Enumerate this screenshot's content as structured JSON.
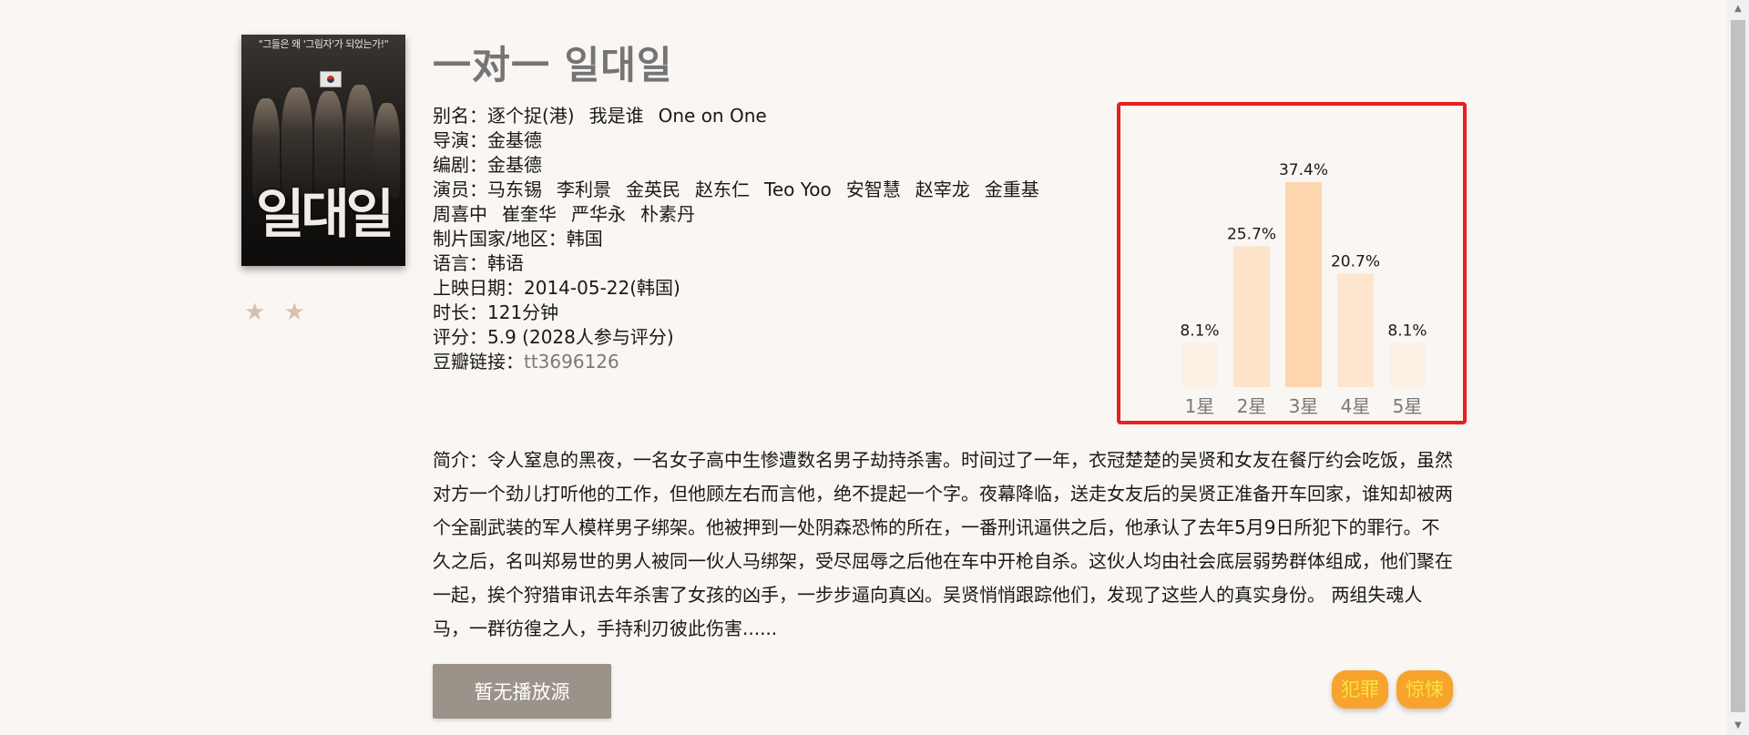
{
  "movie": {
    "title": "一对一 일대일",
    "poster_text": "\"그들은 왜 '그림자'가 되었는가!\"",
    "poster_title": "일대일",
    "rating_stars": "★ ★",
    "info": {
      "aka_label": "别名：",
      "aka": [
        "逐个捉(港)",
        "我是谁",
        "One on One"
      ],
      "director_label": "导演：",
      "director": "金基德",
      "writer_label": "编剧：",
      "writer": "金基德",
      "cast_label": "演员：",
      "cast": [
        "马东锡",
        "李利景",
        "金英民",
        "赵东仁",
        "Teo Yoo",
        "安智慧",
        "赵宰龙",
        "金重基",
        "周喜中",
        "崔奎华",
        "严华永",
        "朴素丹"
      ],
      "country_label": "制片国家/地区：",
      "country": "韩国",
      "language_label": "语言：",
      "language": "韩语",
      "release_label": "上映日期：",
      "release": "2014-05-22(韩国)",
      "runtime_label": "时长：",
      "runtime": "121分钟",
      "score_label": "评分：",
      "score": "5.9 (2028人参与评分)",
      "douban_label": "豆瓣链接：",
      "douban_link": "tt3696126"
    },
    "synopsis": "简介：令人窒息的黑夜，一名女子高中生惨遭数名男子劫持杀害。时间过了一年，衣冠楚楚的吴贤和女友在餐厅约会吃饭，虽然对方一个劲儿打听他的工作，但他顾左右而言他，绝不提起一个字。夜幕降临，送走女友后的吴贤正准备开车回家，谁知却被两个全副武装的军人模样男子绑架。他被押到一处阴森恐怖的所在，一番刑讯逼供之后，他承认了去年5月9日所犯下的罪行。不久之后，名叫郑易世的男人被同一伙人马绑架，受尽屈辱之后他在车中开枪自杀。这伙人均由社会底层弱势群体组成，他们聚在一起，挨个狩猎审讯去年杀害了女孩的凶手，一步步逼向真凶。吴贤悄悄跟踪他们，发现了这些人的真实身份。 两组失魂人马，一群彷徨之人，手持利刃彼此伤害......",
    "play_button": "暂无播放源",
    "tags": [
      "犯罪",
      "惊悚"
    ]
  },
  "chart_data": {
    "type": "bar",
    "categories": [
      "1星",
      "2星",
      "3星",
      "4星",
      "5星"
    ],
    "values": [
      8.1,
      25.7,
      37.4,
      20.7,
      8.1
    ],
    "value_labels": [
      "8.1%",
      "25.7%",
      "37.4%",
      "20.7%",
      "8.1%"
    ],
    "bar_colors": [
      "#fdf1e6",
      "#fde3c9",
      "#fdd5ae",
      "#fde5ce",
      "#fdf1e6"
    ],
    "label_color": "#7a7a7a",
    "highlight_border_color": "#e6201c",
    "ylim": [
      0,
      37.4
    ]
  }
}
